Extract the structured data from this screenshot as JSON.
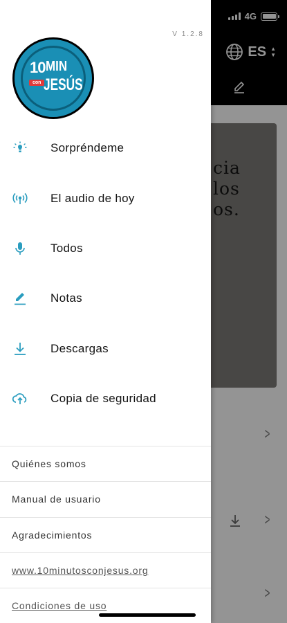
{
  "status_bar": {
    "network": "4G",
    "battery_level": 1.0
  },
  "background": {
    "language_code": "ES",
    "card_text": "cia\nlos\nos."
  },
  "drawer": {
    "version": "V 1.2.8",
    "logo": {
      "number": "10",
      "min": "MIN",
      "con": "con",
      "jesus": "JESÚS"
    },
    "menu": [
      {
        "label": "Sorpréndeme",
        "icon": "lightbulb-icon"
      },
      {
        "label": "El audio de hoy",
        "icon": "broadcast-icon"
      },
      {
        "label": "Todos",
        "icon": "microphone-icon"
      },
      {
        "label": "Notas",
        "icon": "pencil-icon"
      },
      {
        "label": "Descargas",
        "icon": "download-icon"
      },
      {
        "label": "Copia de seguridad",
        "icon": "cloud-upload-icon"
      }
    ],
    "links": [
      {
        "label": "Quiénes somos"
      },
      {
        "label": "Manual de usuario"
      },
      {
        "label": "Agradecimientos"
      },
      {
        "label": "www.10minutosconjesus.org"
      },
      {
        "label": "Condiciones de uso"
      }
    ]
  },
  "colors": {
    "accent": "#2a9dbf",
    "logo_blue": "#1a8fb5",
    "logo_red": "#e23a3a"
  }
}
